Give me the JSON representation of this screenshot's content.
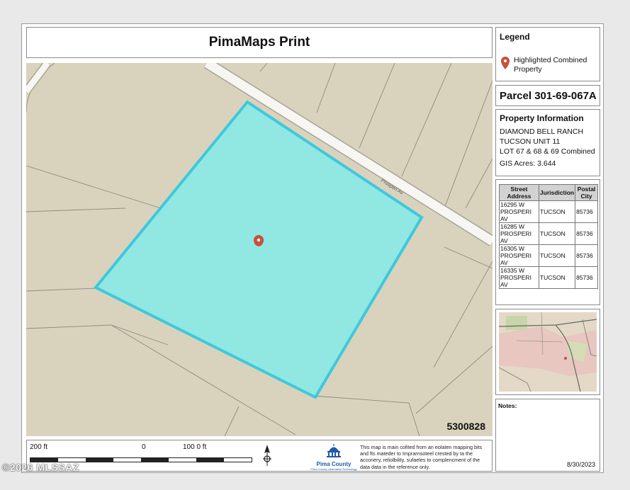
{
  "header": {
    "title": "PimaMaps Print"
  },
  "map": {
    "parcel_number_label": "5300828",
    "road_name": "Prosperi Av",
    "parcel_fill": "#91e8e2",
    "parcel_outline": "#3ec8dc",
    "land_color": "#d9d3bd"
  },
  "scale": {
    "left": "200 ft",
    "middle": "0",
    "right": "100 0 ft"
  },
  "legend": {
    "title": "Legend",
    "label": "Highlighted Combined Property"
  },
  "parcel": {
    "title": "Parcel 301-69-067A"
  },
  "property_info": {
    "title": "Property Information",
    "lines": [
      "DIAMOND BELL RANCH",
      "TUCSON UNIT 11",
      "LOT 67 & 68 & 69 Combined"
    ],
    "acres": "GIS Acres: 3.644"
  },
  "address_table": {
    "headers": [
      "Street Address",
      "Jurisdiction",
      "Postal City"
    ],
    "rows": [
      [
        "16295 W PROSPERI AV",
        "TUCSON",
        "85736"
      ],
      [
        "16285 W PROSPERI AV",
        "TUCSON",
        "85736"
      ],
      [
        "16305 W PROSPERI AV",
        "TUCSON",
        "85736"
      ],
      [
        "16335 W PROSPERI AV",
        "TUCSON",
        "85736"
      ]
    ]
  },
  "logo": {
    "name": "Pima County",
    "tagline": "Pima County Information Technology"
  },
  "disclaimer": "This map is main cofited from an eolaten mapping bits and fts mateder to Imprarnsoteel crested by ta the acconery, reliolbility, sufaeles to complencment of the data data in the reference only.",
  "notes": {
    "title": "Notes:",
    "date": "8/30/2023"
  },
  "watermark": "©2026 MLSSAZ",
  "icons": {
    "pin": "map-pin-icon",
    "north": "north-arrow-icon"
  }
}
